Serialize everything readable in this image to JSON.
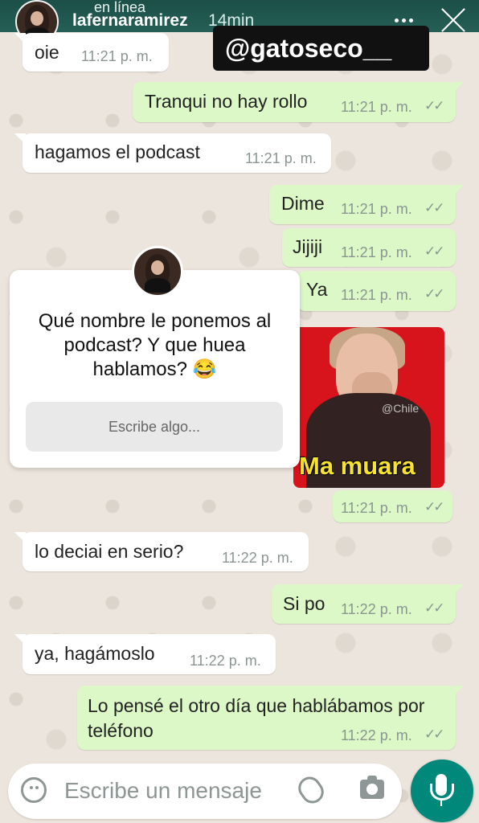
{
  "header": {
    "presence": "en línea",
    "username": "lafernaramirez",
    "time_ago": "14min",
    "mention": "@gatoseco__"
  },
  "messages": [
    {
      "text": "oie",
      "time": "11:21 p. m."
    },
    {
      "text": "Tranqui no hay rollo",
      "time": "11:21 p. m."
    },
    {
      "text": "hagamos el podcast",
      "time": "11:21 p. m."
    },
    {
      "text": "Dime",
      "time": "11:21 p. m."
    },
    {
      "text": "Jijiji",
      "time": "11:21 p. m."
    },
    {
      "text": "Ya",
      "time": "11:21 p. m."
    },
    {
      "text": "",
      "time": "11:21 p. m."
    },
    {
      "text": "lo deciai en serio?",
      "time": "11:22 p. m."
    },
    {
      "text": "Si po",
      "time": "11:22 p. m."
    },
    {
      "text": "ya, hagámoslo",
      "time": "11:22 p. m."
    },
    {
      "text": "Lo pensé el otro día que hablábamos por teléfono",
      "time": "11:22 p. m."
    }
  ],
  "question": {
    "text": "Qué nombre le ponemos al podcast? Y que huea hablamos? 😂",
    "input_placeholder": "Escribe algo..."
  },
  "sticker": {
    "caption": "Ma muara",
    "watermark": "@Chile"
  },
  "composer": {
    "placeholder": "Escribe un mensaje"
  },
  "icons": [
    "more-icon",
    "close-icon",
    "emoji-icon",
    "attach-icon",
    "camera-icon",
    "mic-icon"
  ],
  "colors": {
    "chat_background": "#ece5dd",
    "incoming_bubble": "#ffffff",
    "outgoing_bubble": "#dcf8c6",
    "accent": "#00897b"
  }
}
